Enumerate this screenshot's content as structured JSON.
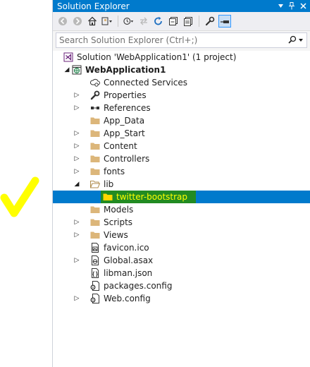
{
  "window": {
    "title": "Solution Explorer"
  },
  "search": {
    "placeholder": "Search Solution Explorer (Ctrl+;)"
  },
  "tree": {
    "solution_label": "Solution 'WebApplication1' (1 project)",
    "project_label": "WebApplication1",
    "items": [
      {
        "label": "Connected Services",
        "icon": "connected-services-icon"
      },
      {
        "label": "Properties",
        "icon": "wrench-icon"
      },
      {
        "label": "References",
        "icon": "references-icon"
      },
      {
        "label": "App_Data",
        "icon": "folder-icon"
      },
      {
        "label": "App_Start",
        "icon": "folder-icon"
      },
      {
        "label": "Content",
        "icon": "folder-icon"
      },
      {
        "label": "Controllers",
        "icon": "folder-icon"
      },
      {
        "label": "fonts",
        "icon": "folder-icon"
      },
      {
        "label": "lib",
        "icon": "folder-icon"
      },
      {
        "label": "twitter-bootstrap",
        "icon": "folder-icon"
      },
      {
        "label": "Models",
        "icon": "folder-icon"
      },
      {
        "label": "Scripts",
        "icon": "folder-icon"
      },
      {
        "label": "Views",
        "icon": "folder-icon"
      },
      {
        "label": "favicon.ico",
        "icon": "image-file-icon"
      },
      {
        "label": "Global.asax",
        "icon": "web-file-icon"
      },
      {
        "label": "libman.json",
        "icon": "json-file-icon"
      },
      {
        "label": "packages.config",
        "icon": "config-file-icon"
      },
      {
        "label": "Web.config",
        "icon": "config-file-icon"
      }
    ]
  },
  "colors": {
    "accent": "#007acc",
    "folder": "#dcb67a",
    "highlight_green": "#228b22",
    "annotation_yellow": "#ffff00"
  }
}
